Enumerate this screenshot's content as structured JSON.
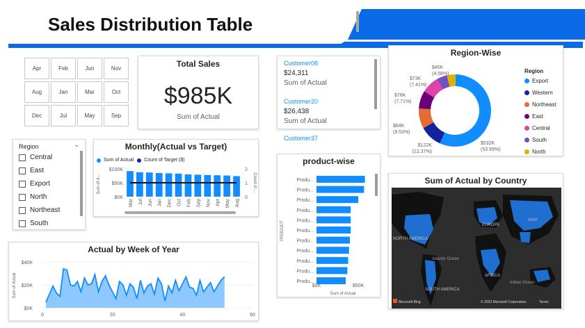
{
  "header": {
    "title": "Sales Distribution Table"
  },
  "month_slicer": {
    "months": [
      "Apr",
      "Feb",
      "Jun",
      "Nov",
      "Aug",
      "Jan",
      "Mar",
      "Oct",
      "Dec",
      "Jul",
      "May",
      "Sep"
    ]
  },
  "total_sales": {
    "title": "Total Sales",
    "value": "$985K",
    "caption": "Sum of Actual"
  },
  "customers": [
    {
      "name": "Customer08",
      "value": "$24,311",
      "caption": "Sum of Actual"
    },
    {
      "name": "Customer20",
      "value": "$26,438",
      "caption": "Sum of Actual"
    },
    {
      "name": "Customer37"
    }
  ],
  "region_slicer": {
    "title": "Region",
    "items": [
      "Central",
      "East",
      "Export",
      "North",
      "Northeast",
      "South"
    ]
  },
  "colors": {
    "blue": "#118dff",
    "navy": "#12239e",
    "orange": "#e66c37",
    "purple": "#6b007b",
    "pink": "#e044a7",
    "violet": "#744ec2",
    "gold": "#d9b300",
    "banner": "#0b6ae8"
  },
  "charts": {
    "region": {
      "title": "Region-Wise",
      "legend_title": "Region",
      "chart_data": {
        "type": "pie",
        "title": "Region-Wise",
        "slices": [
          {
            "label": "Export",
            "value": 532,
            "display": "$532K",
            "pct": "(53.99%)",
            "color": "#118dff"
          },
          {
            "label": "Western",
            "value": 95,
            "display": "",
            "pct": "",
            "color": "#12239e"
          },
          {
            "label": "Northeast",
            "value": 84,
            "display": "$84K",
            "pct": "(8.53%)",
            "color": "#e66c37"
          },
          {
            "label": "East",
            "value": 76,
            "display": "$76K",
            "pct": "(7.71%)",
            "color": "#6b007b"
          },
          {
            "label": "Central",
            "value": 73,
            "display": "$73K",
            "pct": "(7.41%)",
            "color": "#e044a7"
          },
          {
            "label": "South",
            "value": 45,
            "display": "$45K",
            "pct": "(4.58%)",
            "color": "#744ec2"
          },
          {
            "label": "North",
            "value": 36,
            "display": "",
            "pct": "",
            "color": "#d9b300"
          }
        ],
        "extra_label": {
          "display": "$122K",
          "pct": "(12.37%)"
        }
      }
    },
    "monthly": {
      "title": "Monthly(Actual vs Target)",
      "legend": [
        "Sum of Actual",
        "Count of Target ($)"
      ],
      "chart_data": {
        "type": "bar",
        "title": "Monthly(Actual vs Target)",
        "categories": [
          "Mar",
          "Jul",
          "Jun",
          "Jan",
          "Dec",
          "Oct",
          "Feb",
          "Sep",
          "Nov",
          "Apr",
          "May",
          "Aug"
        ],
        "series": [
          {
            "name": "Sum of Actual",
            "values": [
              92,
              88,
              87,
              85,
              84,
              83,
              80,
              79,
              78,
              77,
              76,
              74
            ]
          },
          {
            "name": "Count of Target ($)",
            "values": [
              1,
              1,
              1,
              1,
              1,
              1,
              1,
              1,
              1,
              1,
              1,
              1
            ]
          }
        ],
        "ylabel": "Sum of A...",
        "y2label": "Count of ...",
        "yticks": [
          "$100K",
          "$50K",
          "$0K"
        ],
        "y2ticks": [
          "2",
          "1",
          "0"
        ],
        "ylim": [
          0,
          100
        ],
        "y2lim": [
          0,
          2
        ]
      }
    },
    "product": {
      "title": "product-wise",
      "chart_data": {
        "type": "bar",
        "title": "product-wise",
        "categories": [
          "Produ...",
          "Produ...",
          "Produ...",
          "Produ...",
          "Produ...",
          "Produ...",
          "Produ...",
          "Produ...",
          "Produ...",
          "Produ...",
          "Produ..."
        ],
        "values": [
          58,
          57,
          50,
          41,
          41,
          41,
          40,
          39,
          38,
          37,
          35
        ],
        "xlabel": "Sum of Actual",
        "ylabel": "PRODUCT",
        "xticks": [
          "$0K",
          "$50K"
        ],
        "xlim": [
          0,
          60
        ]
      }
    },
    "weekly": {
      "title": "Actual by Week of Year",
      "chart_data": {
        "type": "area",
        "title": "Actual by Week of Year",
        "x": [
          1,
          2,
          3,
          4,
          5,
          6,
          7,
          8,
          9,
          10,
          11,
          12,
          13,
          14,
          15,
          16,
          17,
          18,
          19,
          20,
          21,
          22,
          23,
          24,
          25,
          26,
          27,
          28,
          29,
          30,
          31,
          32,
          33,
          34,
          35,
          36,
          37,
          38,
          39,
          40,
          41,
          42,
          43,
          44,
          45,
          46,
          47,
          48,
          49,
          50,
          51,
          52
        ],
        "values": [
          5,
          12,
          19,
          13,
          10,
          34,
          33,
          20,
          19,
          23,
          14,
          26,
          20,
          21,
          29,
          14,
          23,
          28,
          20,
          14,
          8,
          23,
          20,
          11,
          21,
          18,
          8,
          24,
          13,
          19,
          21,
          12,
          26,
          21,
          6,
          19,
          13,
          24,
          15,
          21,
          27,
          18,
          17,
          11,
          24,
          14,
          18,
          22,
          14,
          19,
          24,
          27
        ],
        "xlabel": "",
        "ylabel": "Sum of Actual",
        "yticks": [
          "$40K",
          "$20K",
          "$0K"
        ],
        "xticks": [
          "0",
          "20",
          "40",
          "60"
        ],
        "ylim": [
          0,
          40
        ],
        "xlim": [
          0,
          60
        ]
      }
    },
    "map": {
      "title": "Sum of Actual by Country",
      "labels": [
        "NORTH AMERICA",
        "EUROPE",
        "ASIA",
        "Atlantic Ocean",
        "AFRICA",
        "SOUTH AMERICA",
        "Indian Ocean"
      ],
      "attribution": "© 2023 Microsoft Corporation",
      "terms": "Terms",
      "bing": "Microsoft Bing"
    }
  }
}
